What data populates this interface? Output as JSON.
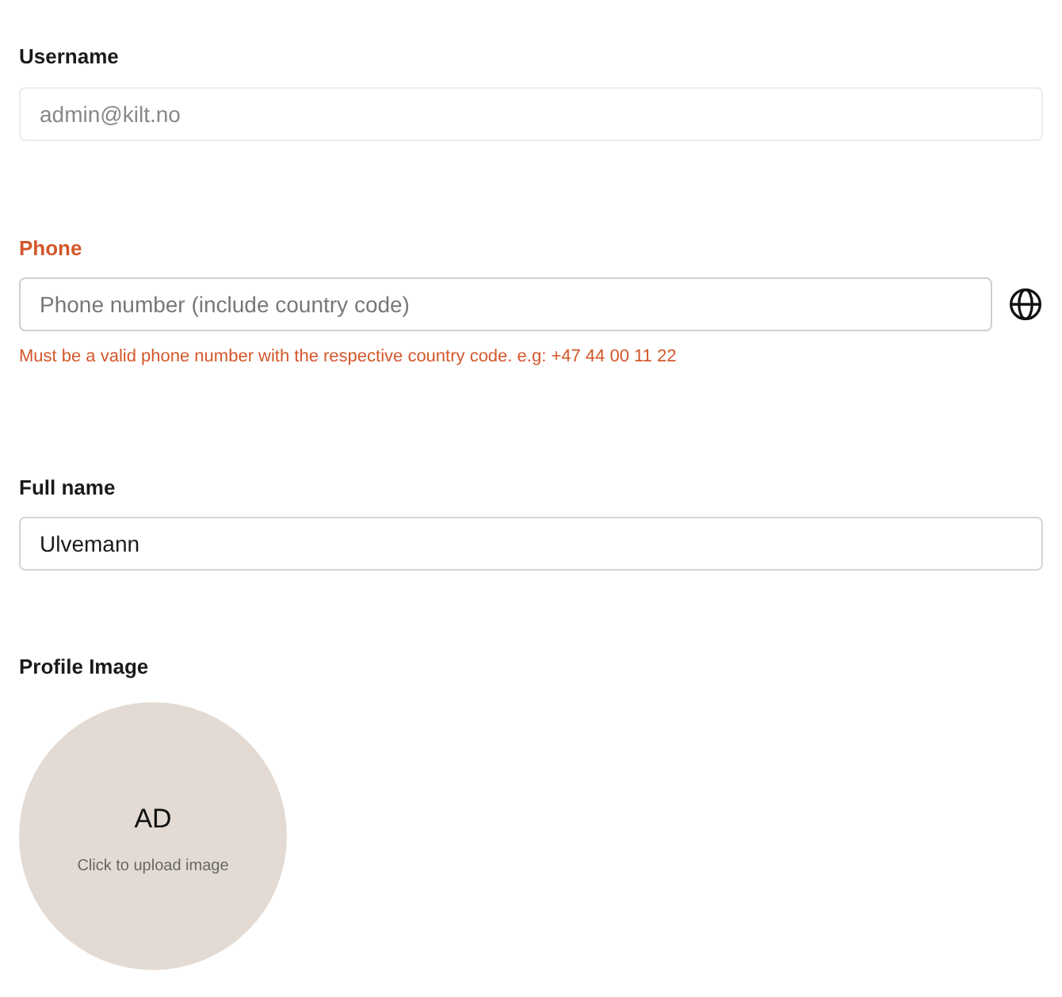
{
  "fields": [
    {
      "label": "Username",
      "value": "admin@kilt.no",
      "disabled": true,
      "error": false
    },
    {
      "label": "Phone",
      "placeholder": "Phone number (include country code)",
      "disabled": false,
      "error": true,
      "error_message": "Must be a valid phone number with the respective country code. e.g: +47 44 00 11 22",
      "globe": true
    },
    {
      "label": "Full name",
      "value": "Ulvemann",
      "disabled": false,
      "error": false
    }
  ],
  "profile_image": {
    "label": "Profile Image",
    "initials": "AD",
    "hint": "Click to upload image"
  }
}
